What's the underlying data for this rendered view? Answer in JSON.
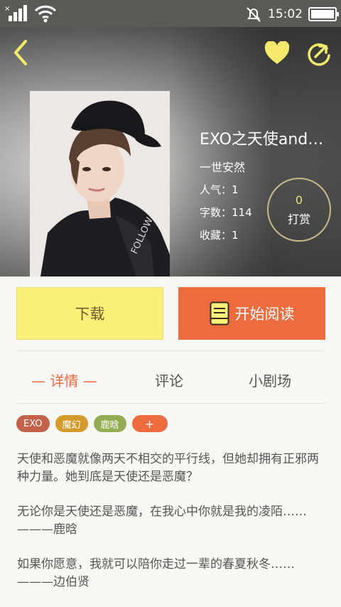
{
  "status_bar": {
    "time": "15:02",
    "signal_icon": "signal-icon",
    "wifi_icon": "wifi-icon",
    "alarm_off_icon": "alarm-off-icon",
    "battery_level": 1.0
  },
  "header": {
    "back_icon": "back-chevron-icon",
    "favorite_icon": "heart-icon",
    "share_icon": "share-icon"
  },
  "book": {
    "title": "EXO之天使and…",
    "author": "一世安然",
    "popularity": "人气：1",
    "word_count": "字数：114",
    "favorites": "收藏：1",
    "tip_count": "0",
    "tip_label": "打赏"
  },
  "actions": {
    "download_label": "下载",
    "read_label": "开始阅读"
  },
  "tabs": [
    {
      "label": "— 详情 —",
      "active": true
    },
    {
      "label": "评论",
      "active": false
    },
    {
      "label": "小剧场",
      "active": false
    }
  ],
  "tags": [
    {
      "label": "EXO",
      "color": "#c3624a"
    },
    {
      "label": "魔幻",
      "color": "#d39a2c"
    },
    {
      "label": "鹿晗",
      "color": "#95ad52"
    },
    {
      "label": "+",
      "color": "#ec6b3f"
    }
  ],
  "description": [
    "天使和恶魔就像两天不相交的平行线，但她却拥有正邪两种力量。她到底是天使还是恶魔？",
    "无论你是天使还是恶魔，在我心中你就是我的凌陌……   ———鹿晗",
    "如果你愿意，我就可以陪你走过一辈的春夏秋冬……   ———边伯贤"
  ],
  "colors": {
    "accent": "#ec6b3f",
    "download_bg": "#fbf178"
  }
}
